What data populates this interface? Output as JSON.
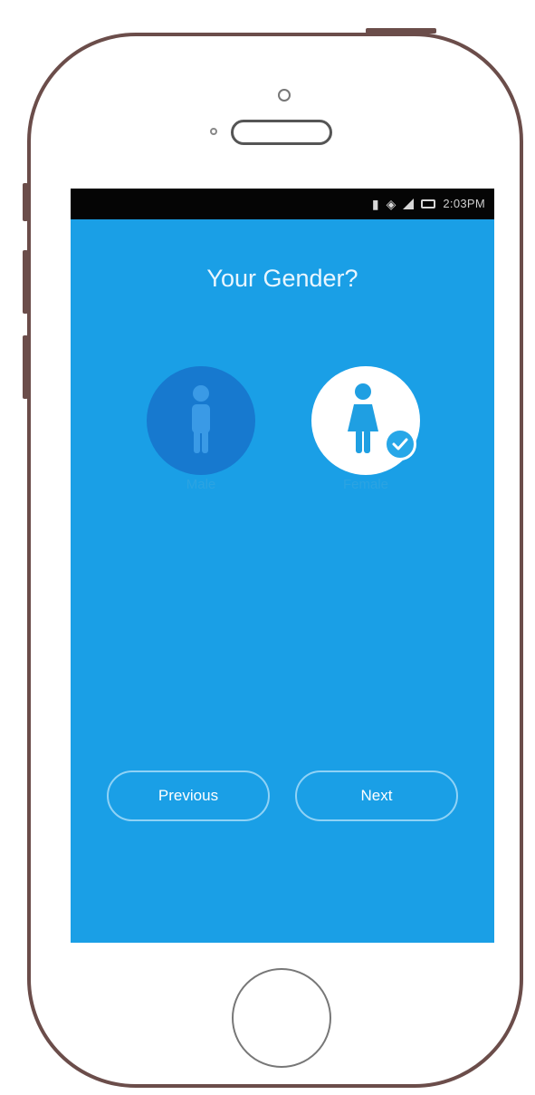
{
  "status_bar": {
    "time": "2:03PM",
    "icons": [
      "notification-icon",
      "wifi-icon",
      "signal-icon",
      "battery-icon"
    ]
  },
  "screen": {
    "title": "Your Gender?",
    "options": [
      {
        "label": "Male",
        "icon": "male-person-icon",
        "selected": false
      },
      {
        "label": "Female",
        "icon": "female-person-icon",
        "selected": true
      }
    ],
    "previous_label": "Previous",
    "next_label": "Next"
  },
  "colors": {
    "screen_bg": "#1a9fe6",
    "unselected_circle": "#1779cf",
    "selected_circle": "#ffffff",
    "phone_outline": "#6b4d4a"
  }
}
